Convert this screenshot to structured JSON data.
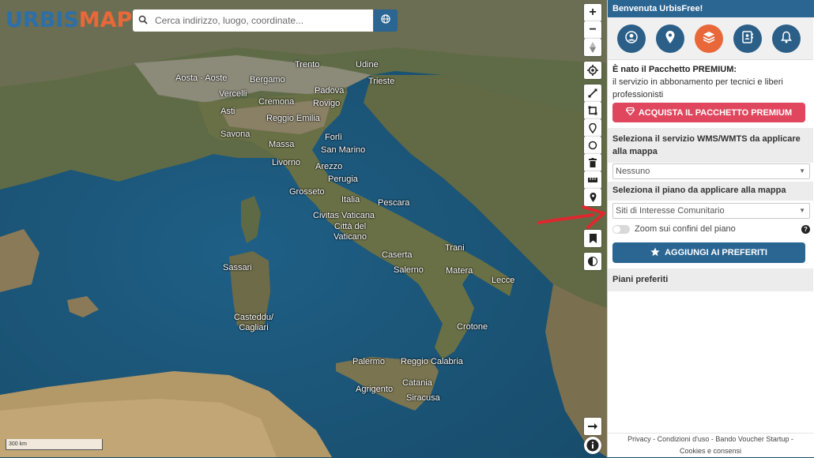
{
  "logo": {
    "part1": "URBIS",
    "part2": "MAP"
  },
  "search": {
    "placeholder": "Cerca indirizzo, luogo, coordinate..."
  },
  "map": {
    "scale_label": "300 km",
    "cities": [
      "Trento",
      "Udine",
      "Aosta - Aoste",
      "Bergamo",
      "Trieste",
      "Vercelli",
      "Padova",
      "Cremona",
      "Rovigo",
      "Asti",
      "Reggio Emilia",
      "Savona",
      "Forlì",
      "Massa",
      "San Marino",
      "Livorno",
      "Arezzo",
      "Perugia",
      "Grosseto",
      "Italia",
      "Pescara",
      "Civitas Vaticana",
      "Città del Vaticano",
      "Sassari",
      "Caserta",
      "Trani",
      "Salerno",
      "Matera",
      "Lecce",
      "Casteddu/ Cagliari",
      "Crotone",
      "Palermo",
      "Reggio Calabria",
      "Catania",
      "Agrigento",
      "Siracusa"
    ]
  },
  "panel": {
    "header": "Benvenuta UrbisFree!",
    "premium_title": "È nato il Pacchetto PREMIUM:",
    "premium_text": "il servizio in abbonamento per tecnici e liberi professionisti",
    "buy_label": "ACQUISTA IL PACCHETTO PREMIUM",
    "wms_title": "Seleziona il servizio WMS/WMTS da applicare alla mappa",
    "wms_value": "Nessuno",
    "plan_title": "Seleziona il piano da applicare alla mappa",
    "plan_value": "Siti di Interesse Comunitario",
    "zoom_label": "Zoom sui confini del piano",
    "fav_label": "AGGIUNGI AI PREFERITI",
    "favorites_title": "Piani preferiti",
    "footer_line1": "Privacy - Condizioni d'uso - Bando Voucher Startup -",
    "footer_line2": "Cookies e consensi"
  },
  "colors": {
    "accent": "#2b6592",
    "brand_orange": "#e8683a",
    "premium": "#e0475e",
    "arrow": "#e0272f"
  }
}
